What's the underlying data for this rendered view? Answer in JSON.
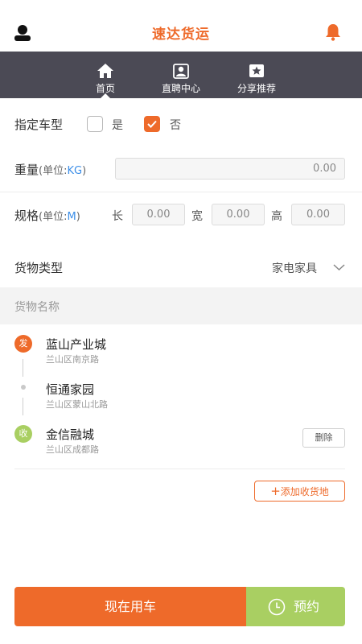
{
  "header": {
    "title": "速达货运"
  },
  "nav": {
    "items": [
      {
        "label": "首页",
        "icon": "home-icon",
        "active": true
      },
      {
        "label": "直聘中心",
        "icon": "recruit-icon",
        "active": false
      },
      {
        "label": "分享推荐",
        "icon": "share-star-icon",
        "active": false
      }
    ]
  },
  "vehicle": {
    "label": "指定车型",
    "yes": "是",
    "no": "否",
    "selected": "否"
  },
  "weight": {
    "label": "重量",
    "unit_prefix": "(单位:",
    "unit": "KG",
    "unit_suffix": ")",
    "value": "0.00"
  },
  "spec": {
    "label": "规格",
    "unit_prefix": "(单位:",
    "unit": "M",
    "unit_suffix": ")",
    "length_label": "长",
    "length": "0.00",
    "width_label": "宽",
    "width": "0.00",
    "height_label": "高",
    "height": "0.00"
  },
  "cargo_type": {
    "label": "货物类型",
    "value": "家电家具"
  },
  "cargo_name": {
    "placeholder": "货物名称"
  },
  "route": {
    "sender": {
      "badge": "发",
      "name": "蓝山产业城",
      "address": "兰山区南京路"
    },
    "stop": {
      "name": "恒通家园",
      "address": "兰山区蒙山北路"
    },
    "receiver": {
      "badge": "收",
      "name": "金信融城",
      "address": "兰山区成都路"
    },
    "delete_label": "删除",
    "add_label": "添加收货地",
    "add_symbol": "+"
  },
  "actions": {
    "now": "现在用车",
    "book": "预约"
  },
  "colors": {
    "accent": "#ee6a2a",
    "nav_bg": "#4b4a55",
    "green": "#a9cf62",
    "unit_blue": "#3b8ee8"
  }
}
